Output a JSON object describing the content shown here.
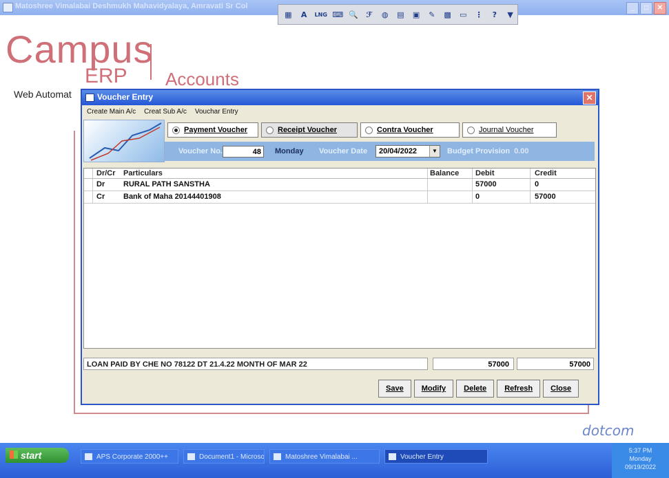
{
  "app": {
    "title": "Matoshree Vimalabai Deshmukh Mahavidyalaya, Amravati Sr Col",
    "toolbar_text": [
      "A",
      "LNG",
      "?"
    ]
  },
  "background": {
    "logo_main": "Campus",
    "logo_sub": "ERP",
    "module": "Accounts",
    "tagline": "Web Automat",
    "brand": "dotcom"
  },
  "voucher_window": {
    "title": "Voucher Entry",
    "menu": [
      "Create Main A/c",
      "Creat Sub A/c",
      "Vouchar Entry"
    ],
    "voucher_types": [
      {
        "label": "Payment Voucher",
        "selected": true
      },
      {
        "label": "Receipt Voucher",
        "selected": false
      },
      {
        "label": "Contra Voucher",
        "selected": false
      },
      {
        "label": "Journal Voucher",
        "selected": false
      }
    ],
    "voucher_no_label": "Voucher No.",
    "voucher_no": "48",
    "day": "Monday",
    "voucher_date_label": "Voucher Date",
    "voucher_date": "20/04/2022",
    "budget_label": "Budget Provision",
    "budget_value": "0.00",
    "columns": [
      "Dr/Cr",
      "Particulars",
      "Balance",
      "Debit",
      "Credit"
    ],
    "rows": [
      {
        "drcr": "Dr",
        "particulars": "RURAL PATH SANSTHA",
        "balance": "",
        "debit": "57000",
        "credit": "0"
      },
      {
        "drcr": "Cr",
        "particulars": "Bank of Maha 20144401908",
        "balance": "",
        "debit": "0",
        "credit": "57000"
      }
    ],
    "narration": "LOAN PAID BY CHE NO 78122 DT 21.4.22 MONTH OF MAR 22",
    "total_debit": "57000",
    "total_credit": "57000",
    "buttons": {
      "save": "Save",
      "modify": "Modify",
      "delete": "Delete",
      "refresh": "Refresh",
      "close": "Close"
    }
  },
  "taskbar": {
    "start": "start",
    "tasks": [
      "APS Corporate 2000++",
      "Document1 - Microsof...",
      "Matoshree Vimalabai ...",
      "Voucher Entry"
    ],
    "time": "5:37 PM",
    "day": "Monday",
    "date": "09/19/2022"
  }
}
